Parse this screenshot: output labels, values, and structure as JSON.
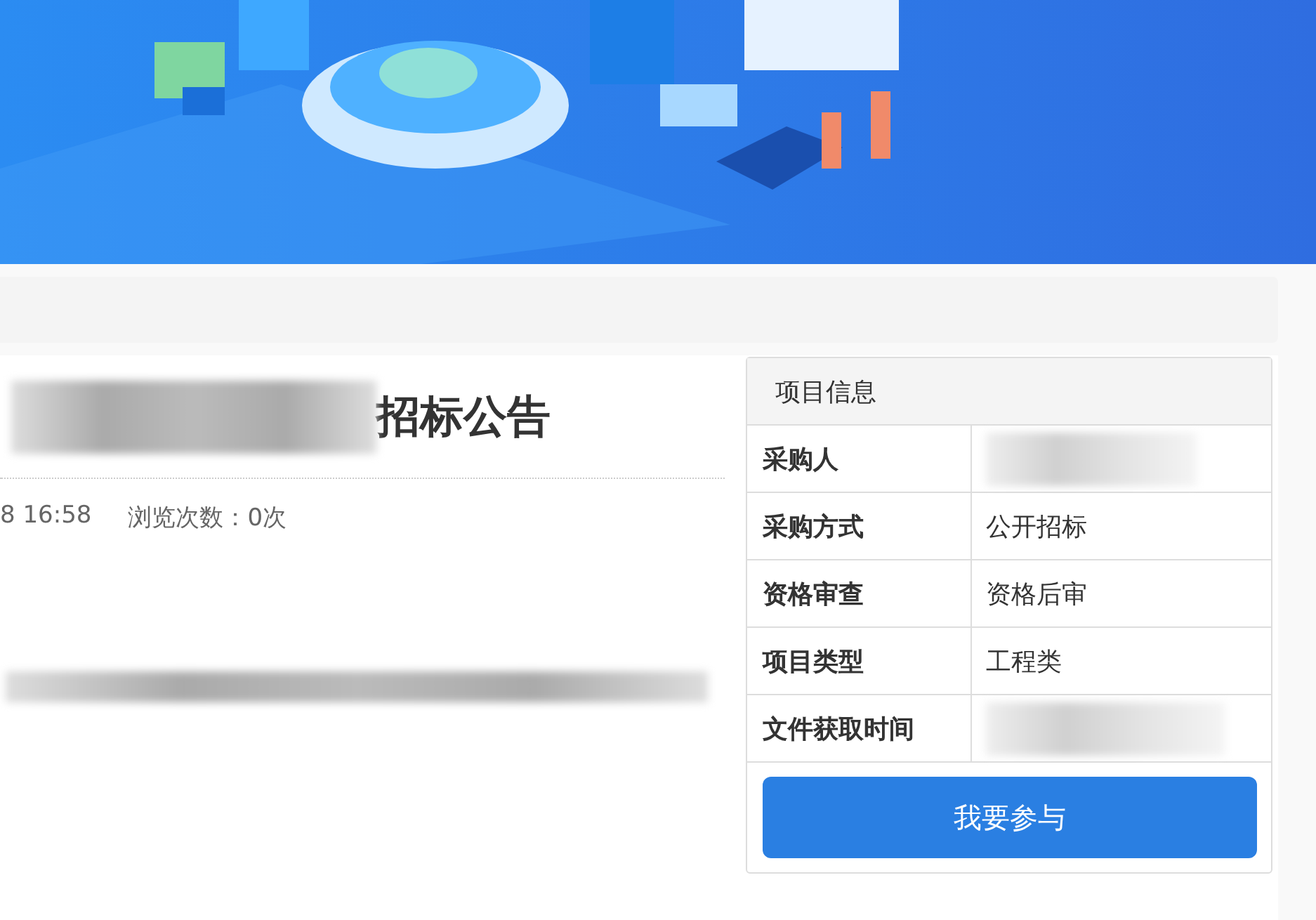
{
  "article": {
    "title": "招标公告",
    "title_redacted": true,
    "publish_time": "8 16:58",
    "views": "浏览次数：0次",
    "body_redacted": true
  },
  "project_info": {
    "title": "项目信息",
    "rows": [
      {
        "label": "采购人",
        "redacted": true
      },
      {
        "label": "采购方式",
        "value": "公开招标",
        "redacted": false
      },
      {
        "label": "资格审查",
        "value": "资格后审",
        "redacted": false
      },
      {
        "label": "项目类型",
        "value": "工程类",
        "redacted": false
      },
      {
        "label": "文件获取时间",
        "redacted": true
      }
    ],
    "button": "我要参与"
  }
}
